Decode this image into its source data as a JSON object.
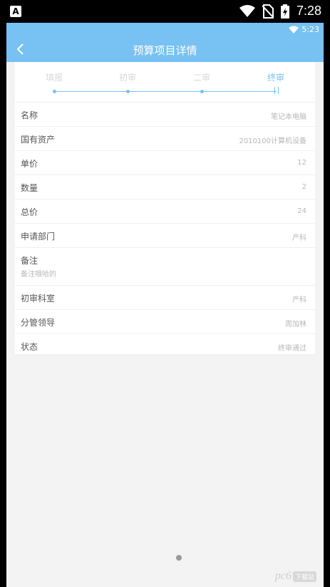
{
  "status_bar": {
    "time": "7:28",
    "app_icon_letter": "A",
    "icons": [
      "wifi-icon",
      "no-sim-icon",
      "battery-charging-icon"
    ]
  },
  "inner_status": {
    "time": "5:23",
    "icon": "wifi-icon"
  },
  "header": {
    "title": "预算项目详情",
    "back_icon": "chevron-left-icon"
  },
  "steps": {
    "labels": [
      "填报",
      "初审",
      "二审",
      "终审"
    ],
    "active_index": 3
  },
  "fields": [
    {
      "label": "名称",
      "value": "笔记本电脑"
    },
    {
      "label": "国有资产",
      "value": "2010100计算机设备"
    },
    {
      "label": "单价",
      "value": "12"
    },
    {
      "label": "数量",
      "value": "2"
    },
    {
      "label": "总价",
      "value": "24"
    },
    {
      "label": "申请部门",
      "value": "产科"
    },
    {
      "label": "备注",
      "value": "",
      "sub": "备注哦哈的"
    },
    {
      "label": "初审科室",
      "value": "产科"
    },
    {
      "label": "分管领导",
      "value": "周加林"
    },
    {
      "label": "状态",
      "value": "终审通过"
    }
  ],
  "watermark": {
    "text": "pc6",
    "badge": "下载站"
  },
  "colors": {
    "header": "#77c1f3",
    "accent": "#77c1f3",
    "background": "#f3f3f3"
  }
}
